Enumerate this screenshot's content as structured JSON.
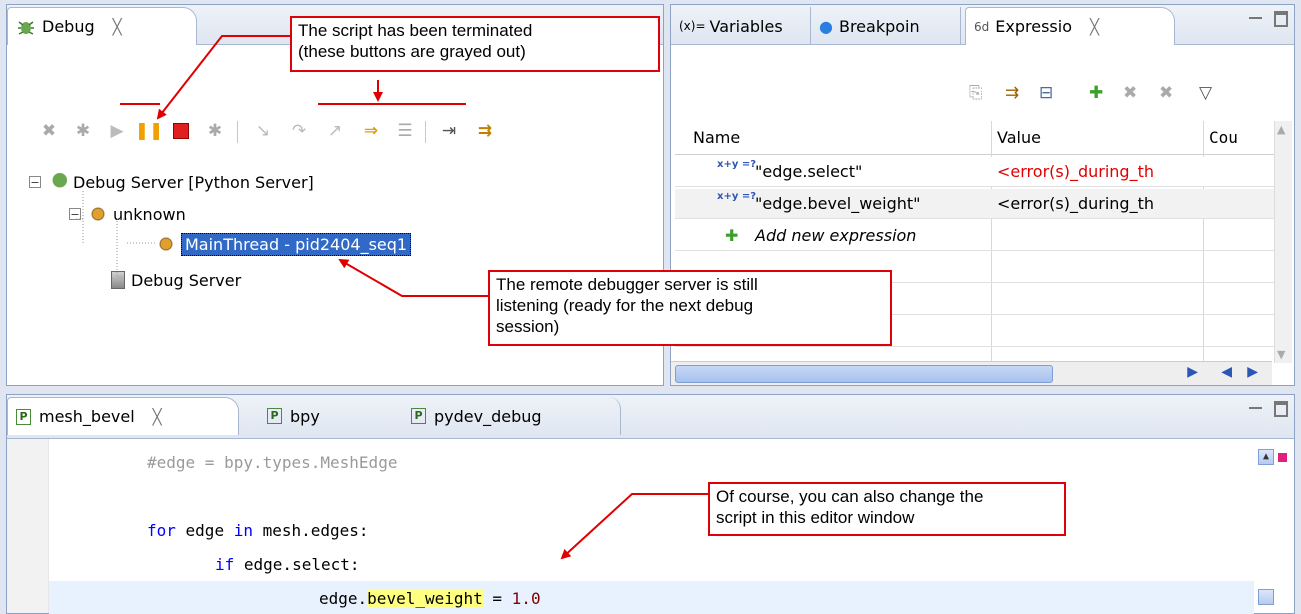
{
  "debug_panel": {
    "tab_label": "Debug",
    "close_glyph": "╳",
    "tree": {
      "root": "Debug Server [Python Server]",
      "node": "unknown",
      "thread": "MainThread - pid2404_seq1",
      "server": "Debug Server"
    }
  },
  "side_panel": {
    "tabs": [
      {
        "label": "Variables"
      },
      {
        "label": "Breakpoin"
      },
      {
        "label": "Expressio"
      }
    ],
    "columns": [
      "Name",
      "Value",
      "Cou"
    ],
    "rows": [
      {
        "icon": "x+y =?",
        "name": "\"edge.select\"",
        "value": "<error(s)_during_th",
        "value_color": "#e00000"
      },
      {
        "icon": "x+y =?",
        "name": "\"edge.bevel_weight\"",
        "value": "<error(s)_during_th",
        "value_color": "#000000"
      }
    ],
    "add_row": "Add new expression"
  },
  "editor": {
    "tabs": [
      {
        "label": "mesh_bevel"
      },
      {
        "label": "bpy"
      },
      {
        "label": "pydev_debug"
      }
    ],
    "lines": {
      "l1": "#edge = bpy.types.MeshEdge",
      "l3_kw1": "for",
      "l3_mid": " edge ",
      "l3_kw2": "in",
      "l3_rest": " mesh.edges:",
      "l4_kw": "if",
      "l4_rest": " edge.select:",
      "l5_a": "edge.",
      "l5_hl": "bevel_weight",
      "l5_b": " = ",
      "l5_num": "1.0"
    }
  },
  "annotations": {
    "terminated_1": "The script has been terminated",
    "terminated_2": "(these buttons are grayed out)",
    "listening_1": "The remote debugger server is still",
    "listening_2": "listening (ready for the next debug",
    "listening_3": "session)",
    "editor_1": "Of course, you can also change the",
    "editor_2": "script in this editor window"
  },
  "colors": {
    "annotation_red": "#e00000",
    "selection_blue": "#3169c6",
    "terminate_red": "#e02020",
    "suspend_orange": "#f0a000"
  }
}
